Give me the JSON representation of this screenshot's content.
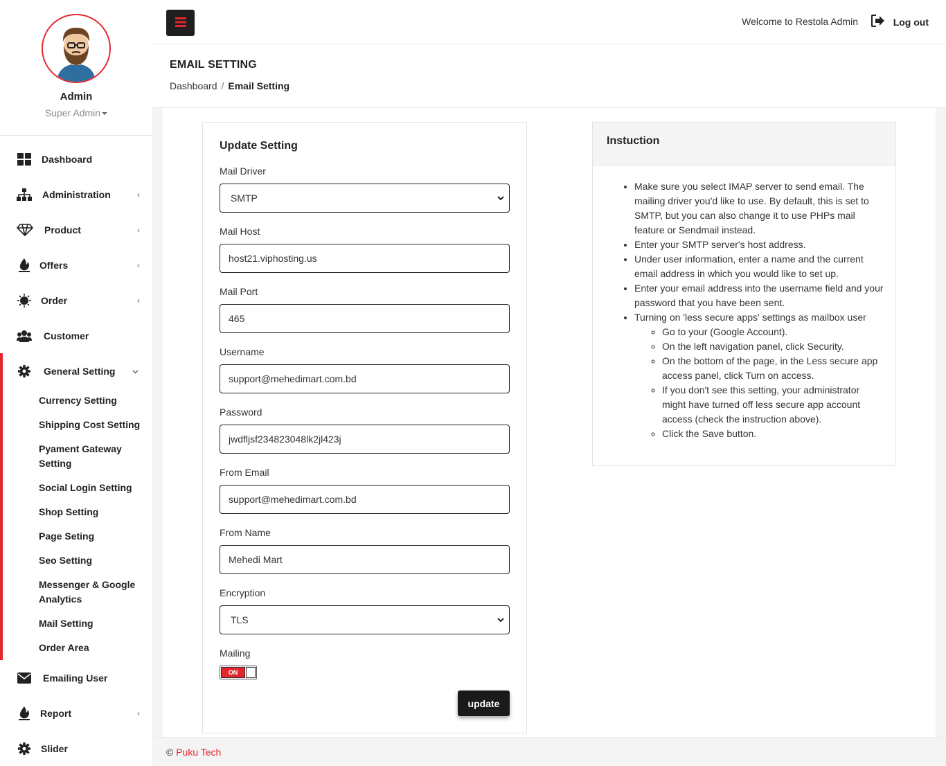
{
  "sidebar": {
    "profile": {
      "name": "Admin",
      "role": "Super Admin"
    },
    "menu": [
      {
        "label": "Dashboard",
        "icon": "dashboard-icon"
      },
      {
        "label": "Administration",
        "icon": "sitemap-icon"
      },
      {
        "label": "Product",
        "icon": "diamond-icon"
      },
      {
        "label": "Offers",
        "icon": "fire-icon"
      },
      {
        "label": "Order",
        "icon": "sun-icon"
      },
      {
        "label": "Customer",
        "icon": "users-icon"
      },
      {
        "label": "General Setting",
        "icon": "gear-icon"
      },
      {
        "label": "Emailing User",
        "icon": "envelope-icon"
      },
      {
        "label": "Report",
        "icon": "fire-icon"
      },
      {
        "label": "Slider",
        "icon": "gear-icon"
      }
    ],
    "general_setting_items": [
      "Currency Setting",
      "Shipping Cost Setting",
      "Pyament Gateway Setting",
      "Social Login Setting",
      "Shop Setting",
      "Page Seting",
      "Seo Setting",
      "Messenger & Google Analytics",
      "Mail Setting",
      "Order Area"
    ]
  },
  "topbar": {
    "welcome": "Welcome to Restola Admin",
    "logout": "Log out"
  },
  "page": {
    "title": "EMAIL SETTING",
    "breadcrumb": {
      "home": "Dashboard",
      "sep": "/",
      "current": "Email Setting"
    }
  },
  "form": {
    "title": "Update Setting",
    "fields": {
      "mail_driver": {
        "label": "Mail Driver",
        "value": "SMTP"
      },
      "mail_host": {
        "label": "Mail Host",
        "value": "host21.viphosting.us"
      },
      "mail_port": {
        "label": "Mail Port",
        "value": "465"
      },
      "username": {
        "label": "Username",
        "value": "support@mehedimart.com.bd"
      },
      "password": {
        "label": "Password",
        "value": "jwdfljsf234823048lk2jl423j"
      },
      "from_email": {
        "label": "From Email",
        "value": "support@mehedimart.com.bd"
      },
      "from_name": {
        "label": "From Name",
        "value": "Mehedi Mart"
      },
      "encryption": {
        "label": "Encryption",
        "value": "TLS"
      },
      "mailing": {
        "label": "Mailing",
        "state": "ON"
      }
    },
    "submit_label": "update"
  },
  "instruction": {
    "title": "Instuction",
    "items": [
      "Make sure you select IMAP server to send email. The mailing driver you'd like to use. By default, this is set to SMTP, but you can also change it to use PHPs mail feature or Sendmail instead.",
      "Enter your SMTP server's host address.",
      "Under user information, enter a name and the current email address in which you would like to set up.",
      "Enter your email address into the username field and your password that you have been sent.",
      "Turning on 'less secure apps' settings as mailbox user"
    ],
    "subitems": [
      "Go to your (Google Account).",
      "On the left navigation panel, click Security.",
      "On the bottom of the page, in the Less secure app access panel, click Turn on access.",
      "If you don't see this setting, your administrator might have turned off less secure app account access (check the instruction above).",
      "Click the Save button."
    ]
  },
  "footer": {
    "copyright": "©",
    "brand": "Puku Tech"
  },
  "colors": {
    "accent": "#e3262d",
    "dark": "#1a1a1a"
  }
}
